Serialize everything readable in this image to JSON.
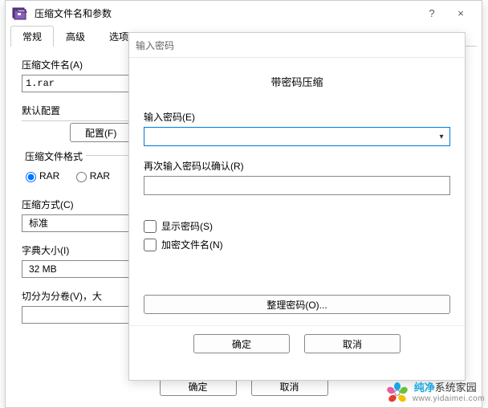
{
  "main": {
    "title": "压缩文件名和参数",
    "help": "?",
    "close": "×",
    "tabs": [
      "常规",
      "高级",
      "选项"
    ],
    "archiveNameLabel": "压缩文件名(A)",
    "archiveName": "1.rar",
    "defaultProfileLabel": "默认配置",
    "configButton": "配置(F)",
    "formatGroup": "压缩文件格式",
    "formatRar": "RAR",
    "formatRar5": "RAR",
    "methodLabel": "压缩方式(C)",
    "methodValue": "标准",
    "dictLabel": "字典大小(I)",
    "dictValue": "32 MB",
    "splitLabel": "切分为分卷(V)，大",
    "ok": "确定",
    "cancel": "取消"
  },
  "pwd": {
    "title": "输入密码",
    "subtitle": "带密码压缩",
    "enterLabel": "输入密码(E)",
    "enterValue": "",
    "confirmLabel": "再次输入密码以确认(R)",
    "confirmValue": "",
    "showPwd": "显示密码(S)",
    "encryptNames": "加密文件名(N)",
    "organize": "整理密码(O)...",
    "ok": "确定",
    "cancel": "取消"
  },
  "watermark": {
    "brand1": "纯净",
    "brand2": "系统家园",
    "url": "www.yidaimei.com"
  }
}
